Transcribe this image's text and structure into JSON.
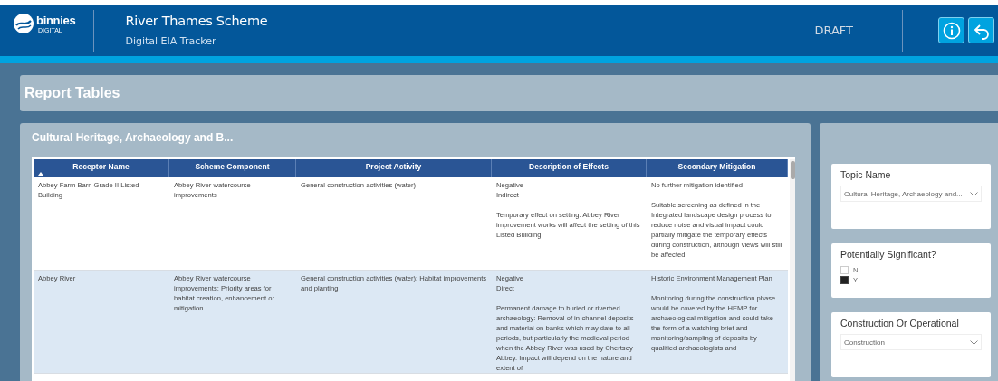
{
  "header": {
    "logo": {
      "name": "binnies",
      "sub": "DIGITAL"
    },
    "title": "River Thames Scheme",
    "subtitle": "Digital EIA Tracker",
    "status": "DRAFT"
  },
  "page_title": "Report Tables",
  "table_panel": {
    "title": "Cultural Heritage, Archaeology and B...",
    "columns": [
      {
        "label": "Receptor Name",
        "sorted": true
      },
      {
        "label": "Scheme Component",
        "sorted": false
      },
      {
        "label": "Project Activity",
        "sorted": false
      },
      {
        "label": "Description of Effects",
        "sorted": false
      },
      {
        "label": "Secondary Mitigation",
        "sorted": false
      }
    ],
    "rows": [
      {
        "selected": false,
        "cells": [
          "Abbey Farm Barn Grade II Listed Building",
          "Abbey River watercourse improvements",
          "General construction activities (water)",
          "Negative\nIndirect\n\nTemporary effect on setting: Abbey River improvement works will affect the setting of this Listed Building.",
          "No further mitigation identified\n\nSuitable screening as defined in the Integrated landscape design process to reduce noise and visual impact could partially mitigate the temporary effects during construction, although views will still be affected."
        ]
      },
      {
        "selected": true,
        "cells": [
          "Abbey River",
          "Abbey River watercourse improvements; Priority areas for habitat creation, enhancement or mitigation",
          "General construction activities (water); Habitat improvements and planting",
          "Negative\nDirect\n\nPermanent damage to buried or riverbed archaeology: Removal of in-channel deposits and material on banks which may date to all periods, but particularly the medieval period when the Abbey River was used by Chertsey Abbey. Impact will depend on the nature and extent of",
          "Historic Environment Management Plan\n\nMonitoring during the construction phase would be covered by the HEMP for archaeological mitigation and could take the form of a watching brief and monitoring/sampling of deposits by qualified archaeologists and"
        ]
      }
    ]
  },
  "filters": [
    {
      "kind": "dropdown",
      "title": "Topic Name",
      "value": "Cultural Heritage, Archaeology and..."
    },
    {
      "kind": "checklist",
      "title": "Potentially Significant?",
      "options": [
        {
          "label": "N",
          "checked": false
        },
        {
          "label": "Y",
          "checked": true
        }
      ]
    },
    {
      "kind": "dropdown",
      "title": "Construction Or Operational",
      "value": "Construction"
    }
  ]
}
